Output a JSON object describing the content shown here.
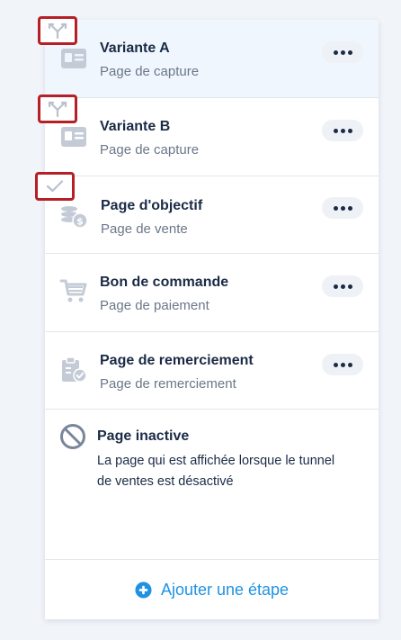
{
  "steps": [
    {
      "title": "Variante A",
      "subtitle": "Page de capture",
      "icon": "capture-page-icon",
      "badge": "split-test-icon",
      "active": true
    },
    {
      "title": "Variante B",
      "subtitle": "Page de capture",
      "icon": "capture-page-icon",
      "badge": "split-test-icon",
      "active": false
    },
    {
      "title": "Page d'objectif",
      "subtitle": "Page de vente",
      "icon": "sales-page-icon",
      "badge": "check-icon",
      "active": false
    },
    {
      "title": "Bon de commande",
      "subtitle": "Page de paiement",
      "icon": "cart-icon",
      "active": false
    },
    {
      "title": "Page de remerciement",
      "subtitle": "Page de remerciement",
      "icon": "clipboard-check-icon",
      "active": false
    }
  ],
  "inactive_page": {
    "title": "Page inactive",
    "description": "La page qui est affichée lorsque le tunnel de ventes est désactivé",
    "icon": "prohibited-icon"
  },
  "add_step": {
    "label": "Ajouter une étape",
    "icon": "plus-circle-icon"
  },
  "colors": {
    "accent": "#1f93e2",
    "active_row": "#eff6fd",
    "badge_border": "#b51f25",
    "title_text": "#1b2b46",
    "muted_text": "#6b7789",
    "icon_gray": "#c4cbd6"
  }
}
